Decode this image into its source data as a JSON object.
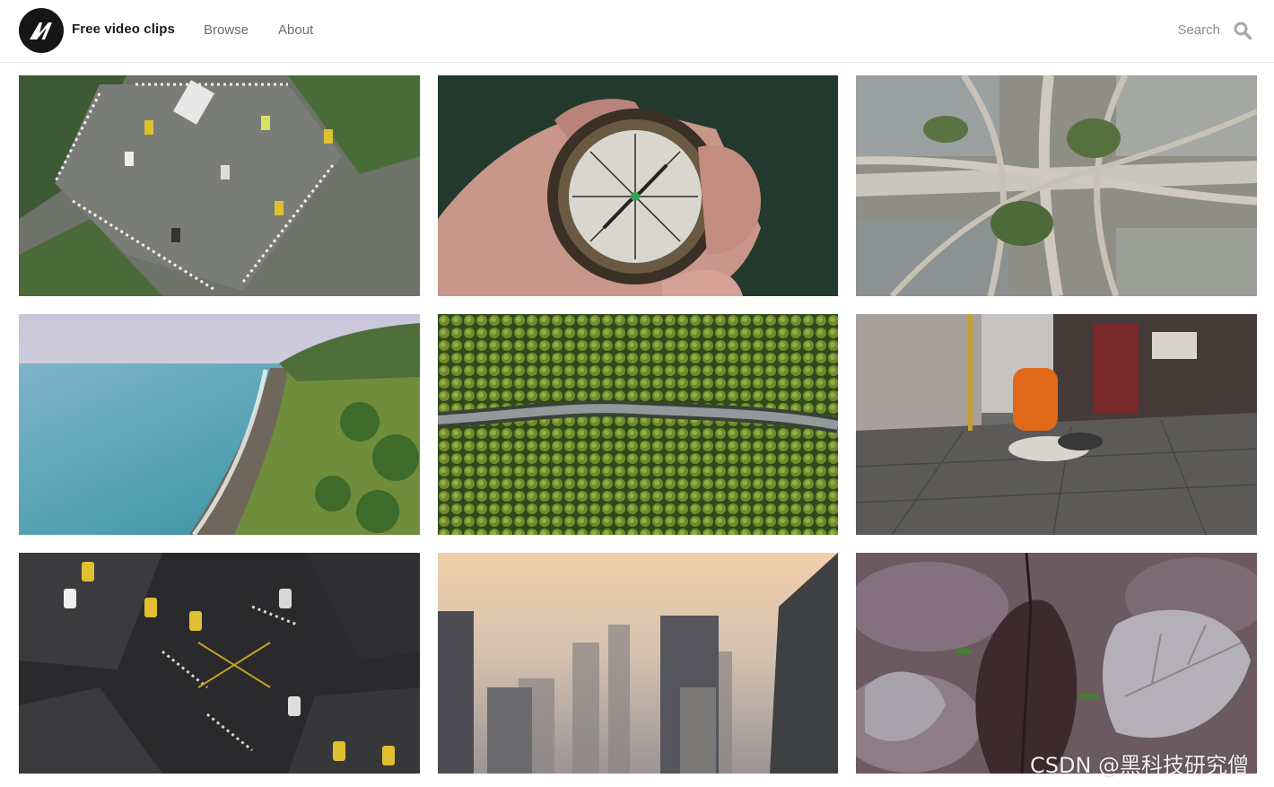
{
  "header": {
    "brand": "Free video clips",
    "nav": [
      {
        "label": "Browse"
      },
      {
        "label": "About"
      }
    ],
    "search": {
      "label": "Search",
      "icon": "search-icon"
    }
  },
  "clips": [
    {
      "subject": "aerial-city-intersection"
    },
    {
      "subject": "hand-holding-compass"
    },
    {
      "subject": "aerial-highway-interchange"
    },
    {
      "subject": "aerial-tropical-beach"
    },
    {
      "subject": "aerial-road-through-forest"
    },
    {
      "subject": "street-with-garbage"
    },
    {
      "subject": "aerial-night-intersection"
    },
    {
      "subject": "foggy-city-skyline"
    },
    {
      "subject": "frosted-autumn-leaves"
    }
  ],
  "watermark": "CSDN @黑科技研究僧",
  "colors": {
    "nav_text": "#6d6d6d",
    "brand_text": "#1a1a1a",
    "logo_bg": "#161616"
  }
}
